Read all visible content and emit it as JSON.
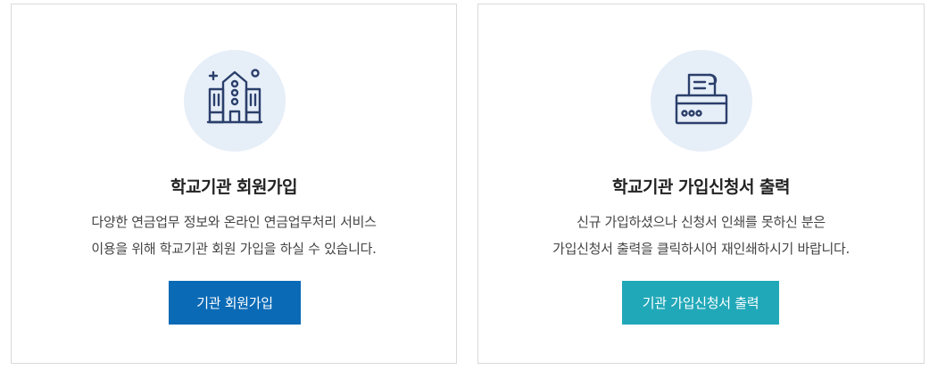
{
  "cards": [
    {
      "title": "학교기관 회원가입",
      "description": [
        "다양한 연금업무 정보와 온라인 연금업무처리 서비스",
        "이용을 위해 학교기관 회원 가입을 하실 수 있습니다."
      ],
      "button_label": "기관 회원가입",
      "icon": "school-building-icon",
      "button_color": "#0a6ab6"
    },
    {
      "title": "학교기관 가입신청서 출력",
      "description": [
        "신규 가입하셨으나 신청서 인쇄를 못하신 분은",
        "가입신청서 출력을 클릭하시어 재인쇄하시기 바랍니다."
      ],
      "button_label": "기관 가입신청서 출력",
      "icon": "printer-icon",
      "button_color": "#21a8b8"
    }
  ],
  "colors": {
    "icon_stroke": "#2b3f6b",
    "icon_background": "#e6eef8",
    "border": "#d9d9d9"
  }
}
